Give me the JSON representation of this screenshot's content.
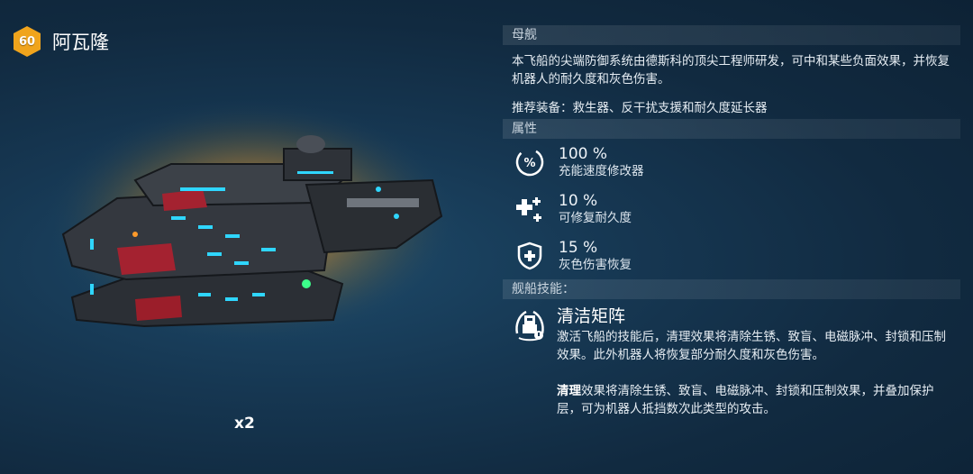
{
  "robot": {
    "level": "60",
    "name": "阿瓦隆",
    "count": "x2"
  },
  "sections": {
    "mothership": "母舰",
    "attributes": "属性",
    "skills": "舰船技能："
  },
  "description": "本飞船的尖端防御系统由德斯科的顶尖工程师研发，可中和某些负面效果，并恢复机器人的耐久度和灰色伤害。",
  "recommended": "推荐装备：救生器、反干扰支援和耐久度延长器",
  "attributes": [
    {
      "value": "100 %",
      "label": "充能速度修改器",
      "icon": "charge-percent-icon"
    },
    {
      "value": "10 %",
      "label": "可修复耐久度",
      "icon": "repair-plus-icon"
    },
    {
      "value": "15 %",
      "label": "灰色伤害恢复",
      "icon": "shield-plus-icon"
    }
  ],
  "skill": {
    "icon": "cleanse-matrix-icon",
    "title": "清洁矩阵",
    "desc": "激活飞船的技能后，清理效果将清除生锈、致盲、电磁脉冲、封锁和压制效果。此外机器人将恢复部分耐久度和灰色伤害。",
    "desc2_bold": "清理",
    "desc2_rest": "效果将清除生锈、致盲、电磁脉冲、封锁和压制效果，并叠加保护层，可为机器人抵挡数次此类型的攻击。"
  },
  "colors": {
    "badge": "#f0a41c",
    "accent_cyan": "#2fd6ff",
    "accent_red": "#c0232e"
  }
}
